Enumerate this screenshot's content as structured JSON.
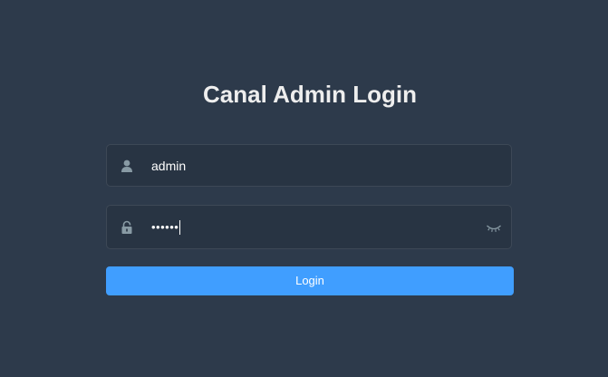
{
  "login": {
    "title": "Canal Admin Login",
    "username": {
      "value": "admin",
      "icon": "user-icon"
    },
    "password": {
      "masked_value": "••••••",
      "icon": "lock-icon",
      "toggle_icon": "eye-closed-icon"
    },
    "submit_label": "Login"
  },
  "colors": {
    "background": "#2d3a4b",
    "input_background": "#283443",
    "button": "#409eff",
    "title_text": "#eeeeee",
    "icon": "#889aa4"
  }
}
